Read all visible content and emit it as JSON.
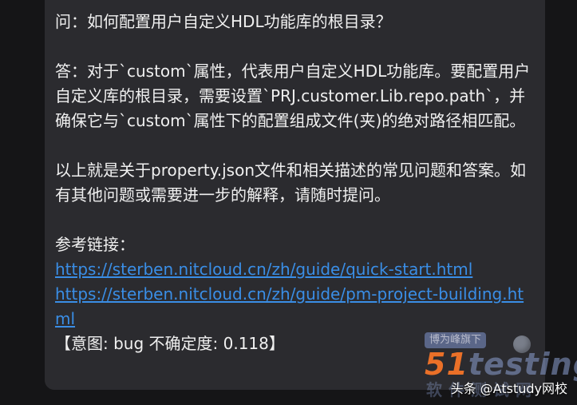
{
  "message": {
    "question": "问：如何配置用户自定义HDL功能库的根目录？",
    "answer": "答：对于`custom`属性，代表用户自定义HDL功能库。要配置用户自定义库的根目录，需要设置`PRJ.customer.Lib.repo.path`，并确保它与`custom`属性下的配置组成文件(夹)的绝对路径相匹配。",
    "summary": "以上就是关于property.json文件和相关描述的常见问题和答案。如有其他问题或需要进一步的解释，请随时提问。",
    "refs_label": "参考链接：",
    "links": [
      "https://sterben.nitcloud.cn/zh/guide/quick-start.html",
      "https://sterben.nitcloud.cn/zh/guide/pm-project-building.html"
    ],
    "intent": "【意图: bug 不确定度: 0.118】"
  },
  "watermark": {
    "badge": "博为峰旗下",
    "logo_num": "51",
    "logo_text": "testing",
    "logo_sub": "软件测试网",
    "source": "头条 @Atstudy网校"
  }
}
